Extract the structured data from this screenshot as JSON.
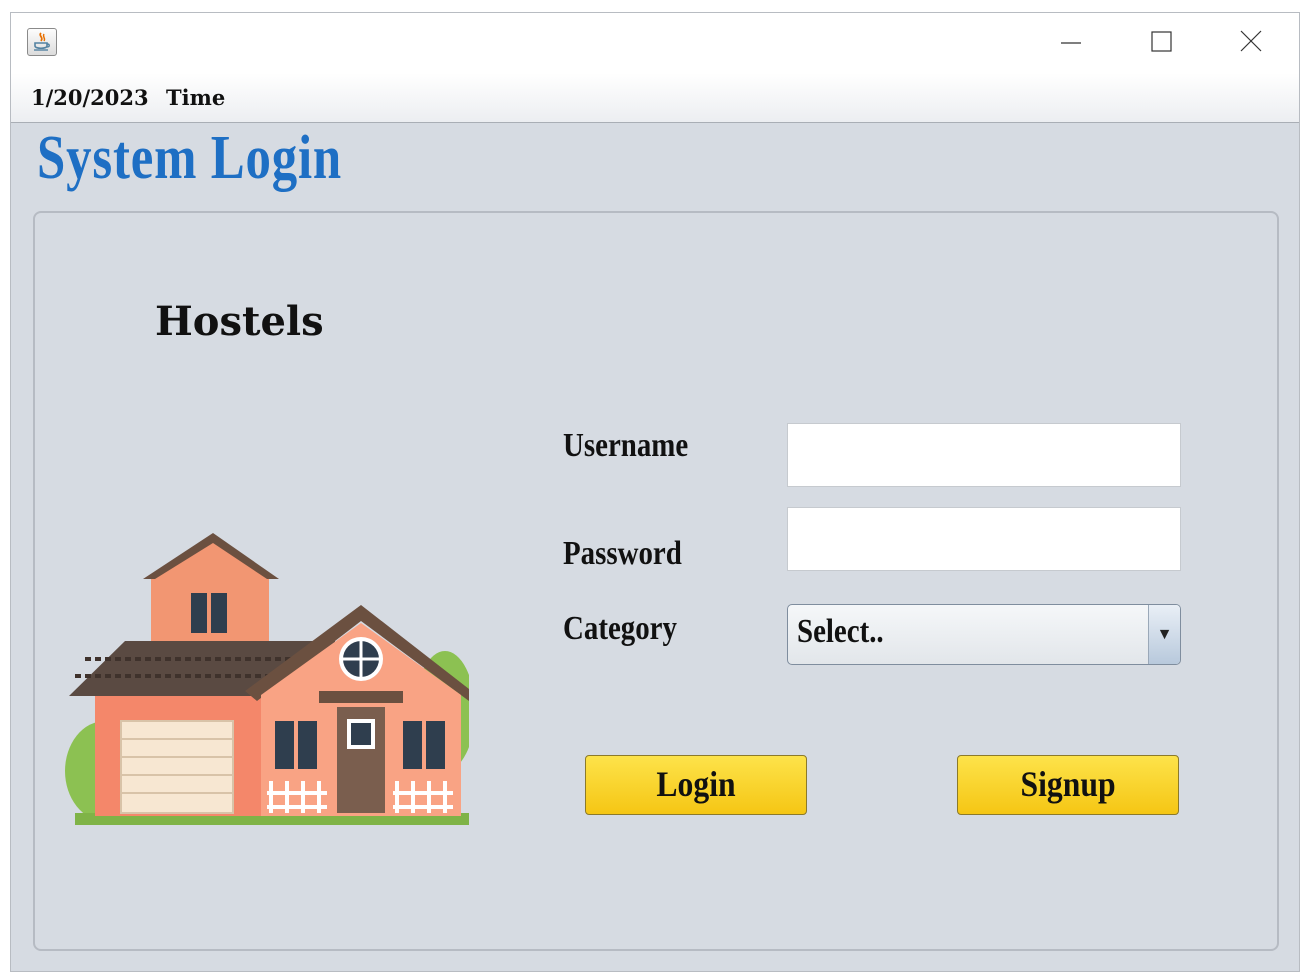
{
  "window": {
    "icon": "java-icon",
    "controls": [
      "minimize-icon",
      "maximize-icon",
      "close-icon"
    ]
  },
  "menubar": {
    "date": "1/20/2023",
    "time_label": "Time"
  },
  "header": {
    "title": "System Login"
  },
  "panel": {
    "brand": "Hostels",
    "illustration": "house-icon"
  },
  "form": {
    "username_label": "Username",
    "username_value": "",
    "password_label": "Password",
    "password_value": "",
    "category_label": "Category",
    "category_selected": "Select.."
  },
  "actions": {
    "login_label": "Login",
    "signup_label": "Signup",
    "button_color": "#f9d21c"
  },
  "colors": {
    "title": "#1e6fc4",
    "background": "#d6dbe2"
  }
}
